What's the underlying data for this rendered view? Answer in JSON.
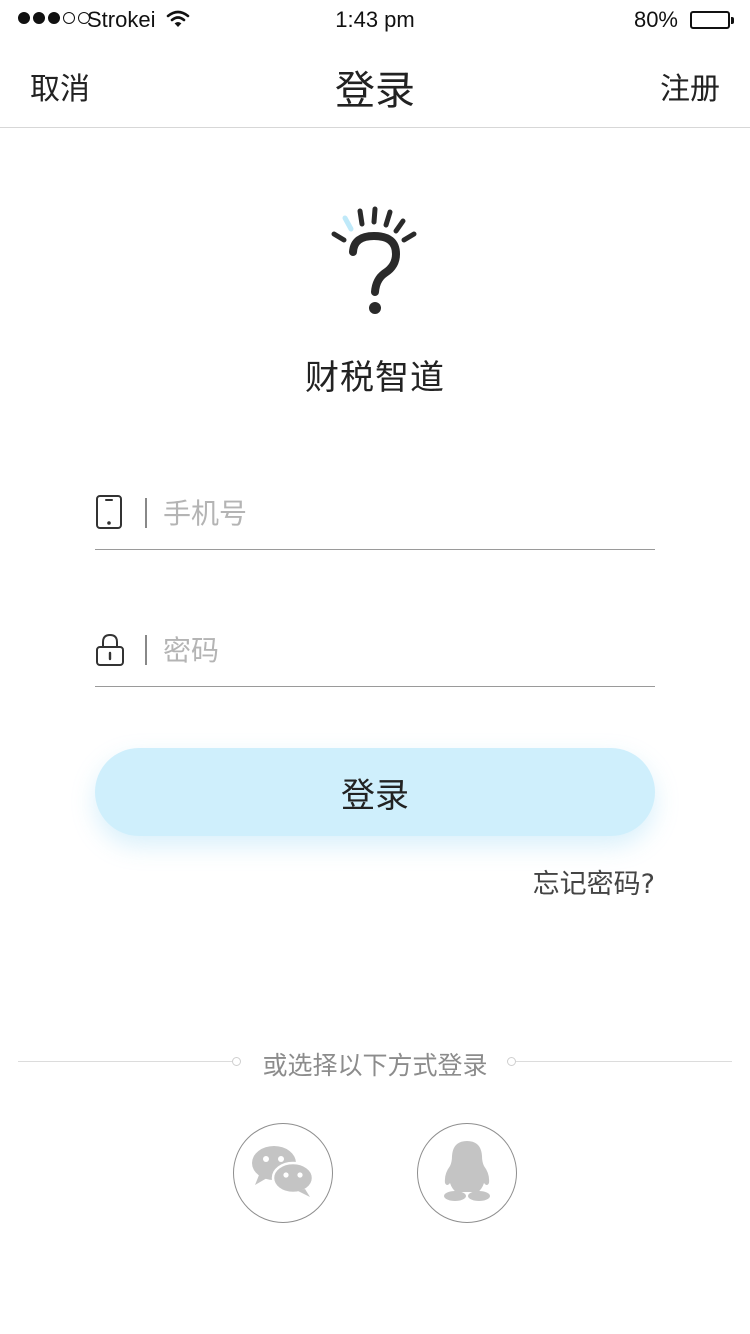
{
  "status_bar": {
    "carrier": "Strokei",
    "time": "1:43 pm",
    "battery": "80%",
    "battery_level": 0.8,
    "signal_bars_filled": 3,
    "signal_bars_total": 5
  },
  "nav": {
    "cancel_label": "取消",
    "title": "登录",
    "register_label": "注册"
  },
  "logo": {
    "icon": "question-mark-logo-icon",
    "app_name": "财税智道"
  },
  "form": {
    "phone": {
      "placeholder": "手机号",
      "value": "",
      "icon": "phone-icon"
    },
    "password": {
      "placeholder": "密码",
      "value": "",
      "icon": "lock-icon"
    },
    "login_label": "登录",
    "forgot_label": "忘记密码?"
  },
  "alternative_login": {
    "caption": "或选择以下方式登录",
    "options": [
      {
        "name": "wechat",
        "icon": "wechat-icon"
      },
      {
        "name": "qq",
        "icon": "qq-icon"
      }
    ]
  },
  "colors": {
    "login_button": "#cfeffc",
    "accent_light_blue": "#bfe9f9",
    "text_dark": "#222222",
    "placeholder": "#b4b4b4",
    "social_icon_gray": "#c4c4c4"
  }
}
